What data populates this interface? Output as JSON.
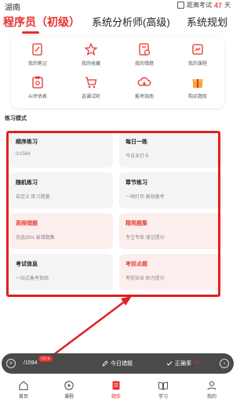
{
  "status": {
    "location": "湖南",
    "exam_label": "距离考试",
    "exam_days": "47",
    "exam_unit": "天"
  },
  "tabs": [
    {
      "label": "程序员（初级）",
      "active": true
    },
    {
      "label": "系统分析师(高级)",
      "active": false
    },
    {
      "label": "系统规划",
      "active": false
    }
  ],
  "tools": [
    {
      "label": "我的笔记",
      "icon": "note-edit-icon"
    },
    {
      "label": "我的收藏",
      "icon": "star-icon"
    },
    {
      "label": "我的错题",
      "icon": "error-book-icon"
    },
    {
      "label": "我的课程",
      "icon": "course-icon"
    },
    {
      "label": "AI评估表",
      "icon": "ai-clipboard-icon"
    },
    {
      "label": "选课试听",
      "icon": "cart-icon"
    },
    {
      "label": "报考指南",
      "icon": "guide-cloud-icon"
    },
    {
      "label": "购买题库",
      "icon": "gift-box-icon"
    }
  ],
  "section_title": "练习模式",
  "practice": [
    {
      "title": "顺序练习",
      "sub": "0/1594"
    },
    {
      "title": "每日一练",
      "sub": "今日未打卡"
    },
    {
      "title": "随机练习",
      "sub": "自定义 练习题量"
    },
    {
      "title": "章节练习",
      "sub": "一网打尽 高效备考"
    },
    {
      "title": "高频错题",
      "sub": "优选35% 易错题集"
    },
    {
      "title": "精简题集",
      "sub": "专注专练 速记提分"
    },
    {
      "title": "考试信息",
      "sub": "一站式备考指南"
    },
    {
      "title": "考前点题",
      "sub": "考前突击 助力提分"
    }
  ],
  "bottom_bar": {
    "count": "/1594",
    "badge": "已打卡",
    "today_wrong": "今日错题",
    "accuracy": "正确率",
    "accuracy_pct": "0%"
  },
  "nav": [
    {
      "label": "首页",
      "icon": "home-icon",
      "active": false
    },
    {
      "label": "课程",
      "icon": "play-course-icon",
      "active": false
    },
    {
      "label": "题库",
      "icon": "question-bank-icon",
      "active": true
    },
    {
      "label": "学习",
      "icon": "book-icon",
      "active": false
    },
    {
      "label": "我的",
      "icon": "user-icon",
      "active": false
    }
  ],
  "colors": {
    "accent": "#e5322d",
    "tile_bg": "#f3f4f6",
    "tile_pink_bg": "#fdeeee",
    "annotation_red": "#e02020"
  }
}
